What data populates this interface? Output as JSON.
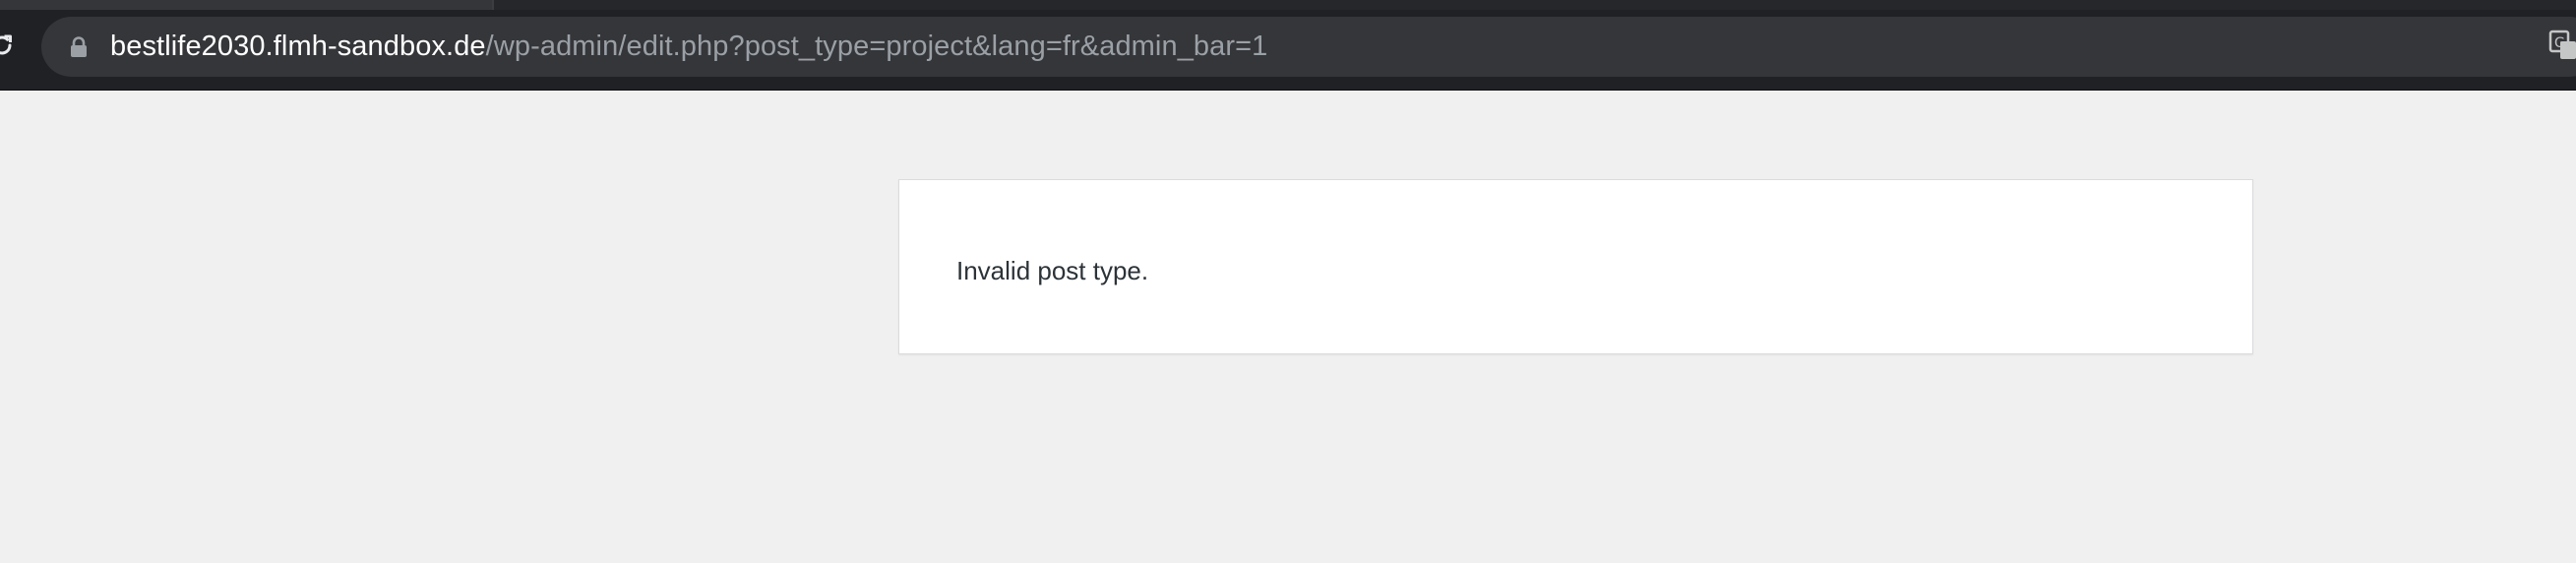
{
  "browser": {
    "url_host": "bestlife2030.flmh-sandbox.de",
    "url_path": "/wp-admin/edit.php?post_type=project&lang=fr&admin_bar=1",
    "icons": {
      "reload": "reload-icon",
      "lock": "lock-icon",
      "extension": "translate-extension-icon"
    }
  },
  "page": {
    "error_message": "Invalid post type."
  },
  "colors": {
    "chrome_bg": "#202124",
    "omnibox_bg": "#35363a",
    "url_host": "#ffffff",
    "url_path": "#9aa0a6",
    "page_bg": "#f0f0f1",
    "error_text": "#2c3338"
  }
}
